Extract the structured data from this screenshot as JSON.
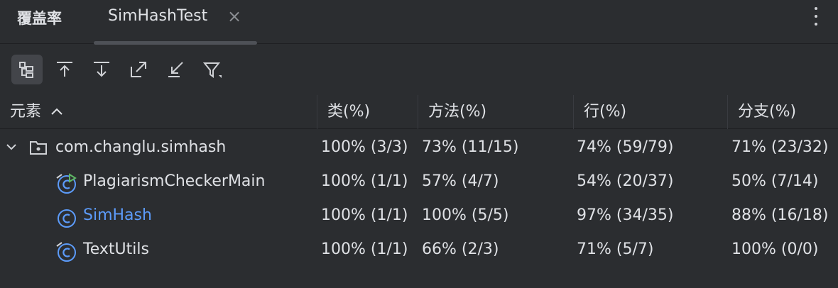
{
  "panel": {
    "title": "覆盖率"
  },
  "tab": {
    "label": "SimHashTest",
    "close": "×"
  },
  "toolbar": {
    "buttons": [
      {
        "icon": "flatten-packages-icon",
        "active": true
      },
      {
        "icon": "navigate-up-icon"
      },
      {
        "icon": "navigate-down-icon"
      },
      {
        "icon": "export-icon"
      },
      {
        "icon": "import-icon"
      },
      {
        "icon": "filter-icon"
      }
    ]
  },
  "columns": {
    "element": "元素",
    "sort": "^",
    "class": "类(%)",
    "method": "方法(%)",
    "line": "行(%)",
    "branch": "分支(%)"
  },
  "rows": [
    {
      "name": "com.changlu.simhash",
      "class": "100% (3/3)",
      "method": "73% (11/15)",
      "line": "74% (59/79)",
      "branch": "71% (23/32)"
    },
    {
      "name": "PlagiarismCheckerMain",
      "class": "100% (1/1)",
      "method": "57% (4/7)",
      "line": "54% (20/37)",
      "branch": "50% (7/14)"
    },
    {
      "name": "SimHash",
      "class": "100% (1/1)",
      "method": "100% (5/5)",
      "line": "97% (34/35)",
      "branch": "88% (16/18)"
    },
    {
      "name": "TextUtils",
      "class": "100% (1/1)",
      "method": "66% (2/3)",
      "line": "71% (5/7)",
      "branch": "100% (0/0)"
    }
  ],
  "colors": {
    "background": "#2b2d30",
    "text": "#dfe1e5",
    "accent": "#5c9bfa",
    "run_green": "#5fb865"
  }
}
